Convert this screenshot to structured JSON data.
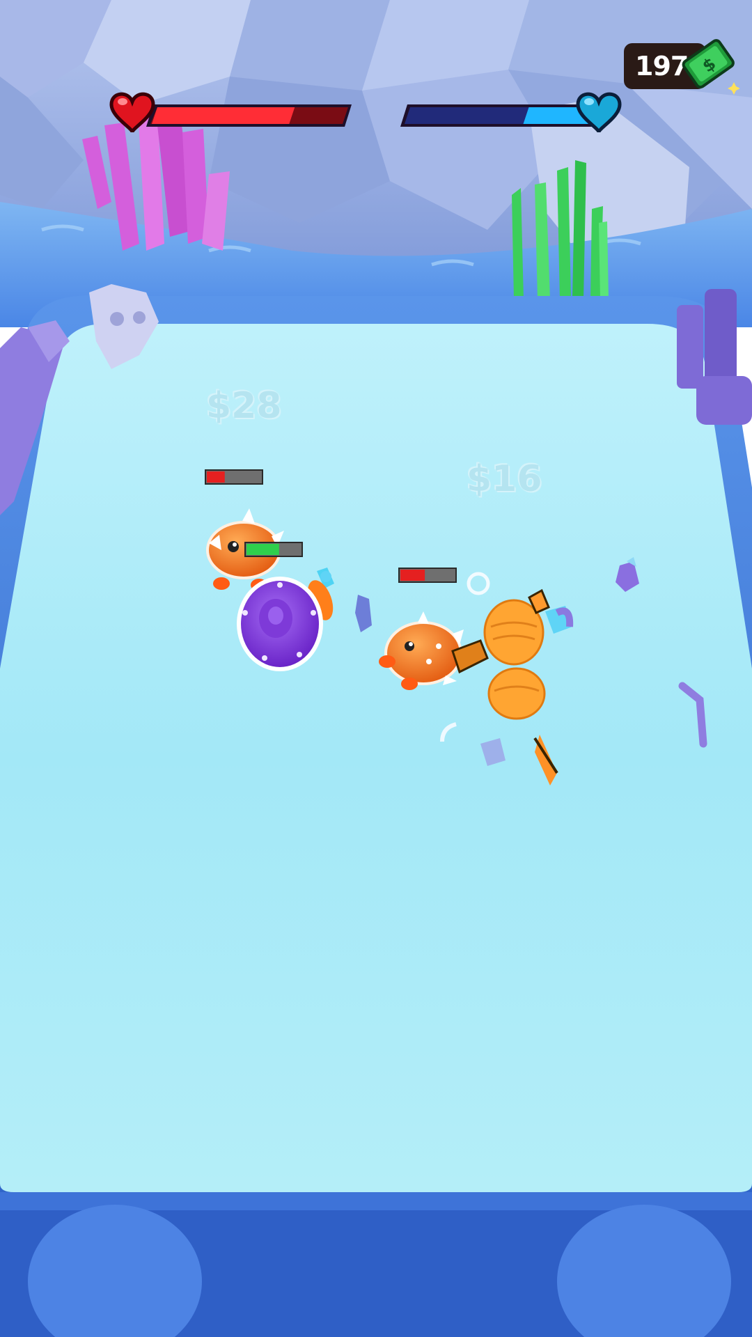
{
  "hud": {
    "player_health": {
      "fill": 0.72,
      "color": "#ff2d36",
      "icon": "red-heart-icon"
    },
    "enemy_health": {
      "fill": 0.38,
      "color": "#1fb6ff",
      "icon": "blue-heart-icon"
    },
    "cash": {
      "amount": "197",
      "icon": "cash-bill-icon"
    }
  },
  "arena": {
    "price_tags": [
      {
        "label": "$28"
      },
      {
        "label": "$16"
      }
    ],
    "units": [
      {
        "name": "pufferfish-enemy-left",
        "health_fill": 0.33,
        "bar_color": "#e52020"
      },
      {
        "name": "purple-sea-urchin-player",
        "health_fill": 0.6,
        "bar_color": "#2fcf4c"
      },
      {
        "name": "pufferfish-enemy-right",
        "health_fill": 0.45,
        "bar_color": "#e52020"
      }
    ]
  },
  "colors": {
    "arena_floor": "#a7e9f7",
    "arena_rim": "#3e7fe0",
    "rock_wall": "#8fa5dc",
    "coral_pink": "#d05ad8",
    "seaweed_green": "#3ccf5a",
    "orange_fish": "#ff8a1e",
    "urchin_purple": "#8a45e0"
  }
}
